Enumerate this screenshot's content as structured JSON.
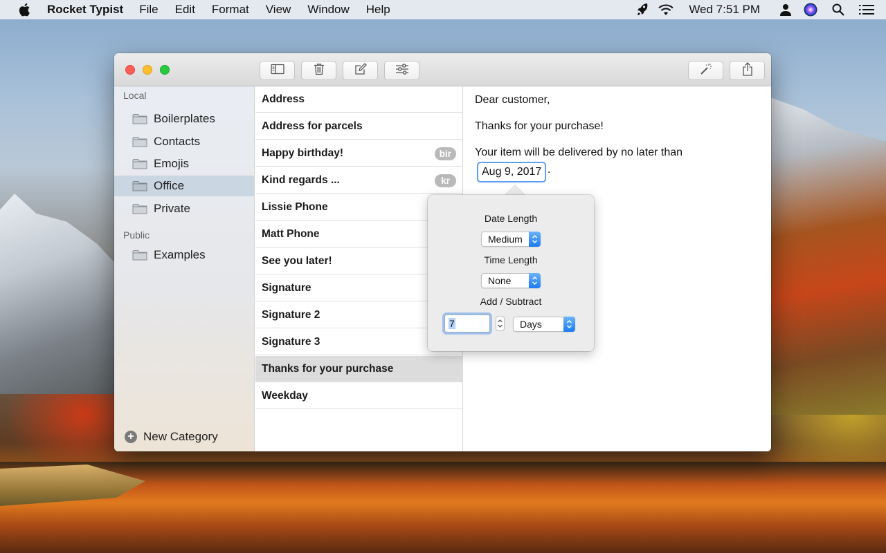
{
  "menubar": {
    "app_name": "Rocket Typist",
    "menus": [
      "File",
      "Edit",
      "Format",
      "View",
      "Window",
      "Help"
    ],
    "status_icons": [
      "rocket-icon",
      "wifi-icon"
    ],
    "clock": "Wed 7:51 PM",
    "right_icons": [
      "user-icon",
      "siri-icon",
      "search-icon",
      "list-icon"
    ]
  },
  "toolbar": {
    "buttons": [
      "sidebar-toggle-icon",
      "trash-icon",
      "compose-icon",
      "sliders-icon",
      "magic-wand-icon",
      "share-icon"
    ]
  },
  "sidebar": {
    "sections": [
      {
        "title": "Local",
        "items": [
          {
            "label": "Boilerplates",
            "selected": false
          },
          {
            "label": "Contacts",
            "selected": false
          },
          {
            "label": "Emojis",
            "selected": false
          },
          {
            "label": "Office",
            "selected": true
          },
          {
            "label": "Private",
            "selected": false
          }
        ]
      },
      {
        "title": "Public",
        "items": [
          {
            "label": "Examples",
            "selected": false
          }
        ]
      }
    ],
    "new_category_label": "New Category"
  },
  "snippets": [
    {
      "title": "Address",
      "abbr": ""
    },
    {
      "title": "Address for parcels",
      "abbr": ""
    },
    {
      "title": "Happy birthday!",
      "abbr": "bir"
    },
    {
      "title": "Kind regards ...",
      "abbr": "kr"
    },
    {
      "title": "Lissie Phone",
      "abbr": ""
    },
    {
      "title": "Matt Phone",
      "abbr": ""
    },
    {
      "title": "See you later!",
      "abbr": ""
    },
    {
      "title": "Signature",
      "abbr": ""
    },
    {
      "title": "Signature 2",
      "abbr": ""
    },
    {
      "title": "Signature 3",
      "abbr": ""
    },
    {
      "title": "Thanks for your purchase",
      "abbr": "",
      "selected": true
    },
    {
      "title": "Weekday",
      "abbr": ""
    }
  ],
  "editor": {
    "line1": "Dear customer,",
    "line2": "Thanks for your purchase!",
    "line3": "Your item will be delivered by no later than",
    "date_token": "Aug 9, 2017",
    "trailing": "."
  },
  "popover": {
    "date_length_label": "Date Length",
    "date_length_value": "Medium",
    "time_length_label": "Time Length",
    "time_length_value": "None",
    "add_subtract_label": "Add / Subtract",
    "add_subtract_value": "7",
    "unit_value": "Days"
  },
  "colors": {
    "accent": "#1c7cf4",
    "sidebar_selected": "#cbd6e3",
    "list_selected": "#dcdcdc"
  }
}
